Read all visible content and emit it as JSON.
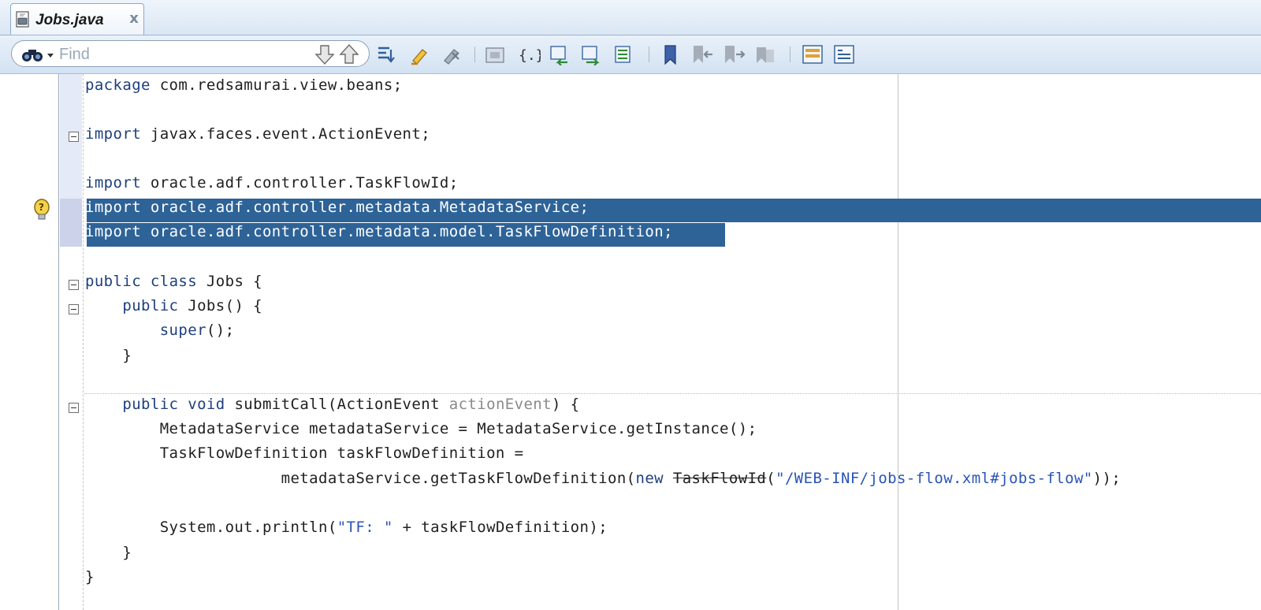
{
  "tab": {
    "title": "Jobs.java",
    "close_glyph": "x"
  },
  "find": {
    "placeholder": "Find",
    "value": ""
  },
  "toolbar_icons": [
    "find-next-icon",
    "find-previous-icon",
    "toggle-highlight-icon",
    "highlight-icon",
    "clear-highlight-icon",
    "surround-with-icon",
    "match-braces-icon",
    "previous-edit-icon",
    "next-edit-icon",
    "toggle-comment-icon",
    "toggle-bookmark-icon",
    "previous-bookmark-icon",
    "next-bookmark-icon",
    "clear-bookmarks-icon",
    "split-editor-icon",
    "properties-icon"
  ],
  "gutter": {
    "hint_icon": "lightbulb-icon"
  },
  "colors": {
    "keyword": "#1e3f7d",
    "string": "#2a55b5",
    "selection": "#2e6398",
    "parameter": "#8a8a8a",
    "toolbar": "#d3e2f2"
  },
  "code": {
    "l1": {
      "kw1": "package",
      "text": " com.redsamurai.view.beans;"
    },
    "l3": {
      "kw1": "import",
      "text": " javax.faces.event.ActionEvent;"
    },
    "l5": {
      "kw1": "import",
      "text": " oracle.adf.controller.TaskFlowId;"
    },
    "l6": {
      "kw1": "import",
      "text": " oracle.adf.controller.metadata.MetadataService;"
    },
    "l7": {
      "kw1": "import",
      "text": " oracle.adf.controller.metadata.model.TaskFlowDefinition;"
    },
    "l9": {
      "kw1": "public",
      "kw2": "class",
      "text": " Jobs {"
    },
    "l10": {
      "indent": "    ",
      "kw1": "public",
      "text": " Jobs() {"
    },
    "l11": {
      "indent": "        ",
      "kw1": "super",
      "text": "();"
    },
    "l12": {
      "text": "    }"
    },
    "l14": {
      "indent": "    ",
      "kw1": "public",
      "kw2": "void",
      "pre": " submitCall(ActionEvent ",
      "param": "actionEvent",
      "post": ") {"
    },
    "l15": {
      "pre": "        MetadataService metadataService = MetadataService.",
      "italic": "getInstance",
      "post": "();"
    },
    "l16": {
      "text": "        TaskFlowDefinition taskFlowDefinition ="
    },
    "l17": {
      "pre": "                     metadataService.getTaskFlowDefinition(",
      "kw1": "new",
      "gap": " ",
      "strike": "TaskFlowId",
      "open": "(",
      "string": "\"/WEB-INF/jobs-flow.xml#jobs-flow\"",
      "post": "));"
    },
    "l19": {
      "pre": "        System.",
      "bold_italic": "out",
      "mid": ".println(",
      "string": "\"TF: \"",
      "post": " + taskFlowDefinition);"
    },
    "l20": {
      "text": "    }"
    },
    "l21": {
      "text": "}"
    }
  }
}
